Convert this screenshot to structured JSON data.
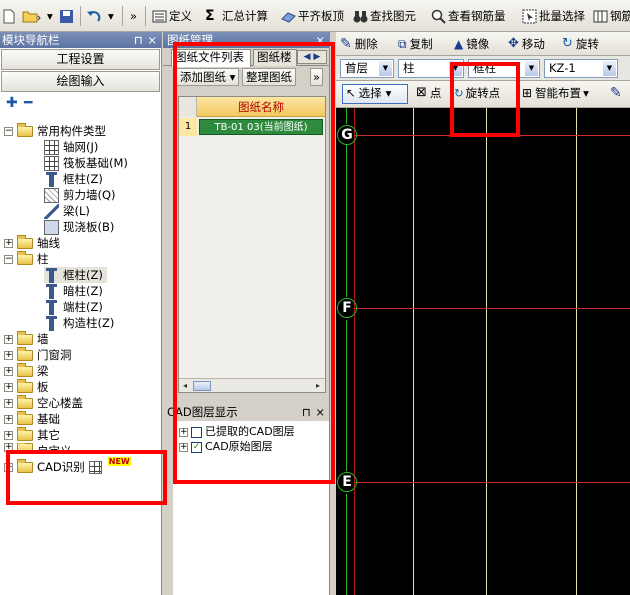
{
  "toolbar": {
    "items": [
      {
        "label": "定义",
        "icon": "define-icon"
      },
      {
        "label": "汇总计算",
        "icon": "sigma-icon"
      },
      {
        "label": "平齐板顶",
        "icon": "align-slab-icon"
      },
      {
        "label": "查找图元",
        "icon": "binoculars-icon"
      },
      {
        "label": "查看钢筋量",
        "icon": "view-rebar-icon"
      },
      {
        "label": "批量选择",
        "icon": "batch-select-icon"
      },
      {
        "label": "钢筋",
        "icon": "rebar-icon"
      }
    ],
    "overflow": "»"
  },
  "nav": {
    "title": "模块导航栏",
    "pin": "⊓",
    "close": "×",
    "buttons": [
      "工程设置",
      "绘图输入"
    ],
    "tree": [
      {
        "label": "常用构件类型",
        "kind": "folder",
        "expanded": true
      },
      {
        "label": "轴网(J)",
        "kind": "grid"
      },
      {
        "label": "筏板基础(M)",
        "kind": "raft"
      },
      {
        "label": "框柱(Z)",
        "kind": "col"
      },
      {
        "label": "剪力墙(Q)",
        "kind": "wall"
      },
      {
        "label": "梁(L)",
        "kind": "beam"
      },
      {
        "label": "现浇板(B)",
        "kind": "slab"
      },
      {
        "label": "轴线",
        "kind": "folder",
        "expanded": false
      },
      {
        "label": "柱",
        "kind": "folder",
        "expanded": true
      },
      {
        "label": "框柱(Z)",
        "kind": "col",
        "selected": true
      },
      {
        "label": "暗柱(Z)",
        "kind": "col"
      },
      {
        "label": "端柱(Z)",
        "kind": "col"
      },
      {
        "label": "构造柱(Z)",
        "kind": "col2"
      },
      {
        "label": "墙",
        "kind": "folder",
        "expanded": false
      },
      {
        "label": "门窗洞",
        "kind": "folder",
        "expanded": false
      },
      {
        "label": "梁",
        "kind": "folder",
        "expanded": false
      },
      {
        "label": "板",
        "kind": "folder",
        "expanded": false
      },
      {
        "label": "空心楼盖",
        "kind": "folder",
        "expanded": false
      },
      {
        "label": "基础",
        "kind": "folder",
        "expanded": false
      },
      {
        "label": "其它",
        "kind": "folder",
        "expanded": false
      },
      {
        "label": "自定义",
        "kind": "folder",
        "expanded": false
      },
      {
        "label": "CAD识别",
        "kind": "folder",
        "expanded": false,
        "badge": "NEW"
      }
    ]
  },
  "drawings": {
    "title": "图纸管理",
    "close": "×",
    "tabs": [
      "图纸文件列表",
      "图纸楼"
    ],
    "tab_arrows": "◀ ▶",
    "tools": [
      "添加图纸",
      "整理图纸"
    ],
    "tools_overflow": "»",
    "column_header": "图纸名称",
    "rows": [
      {
        "no": "1",
        "name": "TB-01 03(当前图纸)"
      }
    ]
  },
  "layers": {
    "title": "CAD图层显示",
    "pin": "⊓",
    "close": "×",
    "items": [
      {
        "label": "已提取的CAD图层",
        "checked": false
      },
      {
        "label": "CAD原始图层",
        "checked": true
      }
    ]
  },
  "edit_toolbar": {
    "items": [
      "删除",
      "复制",
      "镜像",
      "移动",
      "旋转"
    ]
  },
  "selectors": {
    "floor": "首层",
    "type": "柱",
    "subtype": "框柱",
    "name": "KZ-1"
  },
  "draw_toolbar": {
    "select": "选择",
    "point": "点",
    "rotate_point": "旋转点",
    "smart_place": "智能布置"
  },
  "canvas": {
    "axis_labels": [
      "G",
      "F",
      "E"
    ],
    "line_color": "#d22b2b",
    "vertical_color": "#e4e0a8",
    "axis_color": "#2cb52c"
  },
  "annotation_color": "#ff0000"
}
